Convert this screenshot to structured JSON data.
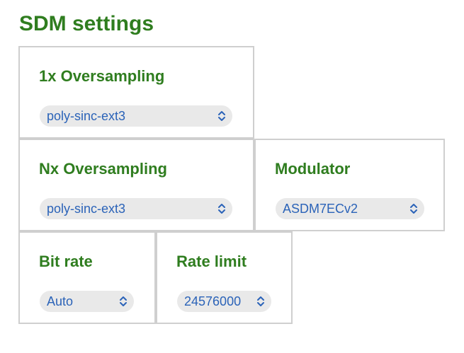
{
  "page": {
    "title": "SDM settings"
  },
  "settings": {
    "oversampling_1x": {
      "label": "1x Oversampling",
      "value": "poly-sinc-ext3"
    },
    "oversampling_nx": {
      "label": "Nx Oversampling",
      "value": "poly-sinc-ext3"
    },
    "modulator": {
      "label": "Modulator",
      "value": "ASDM7ECv2"
    },
    "bit_rate": {
      "label": "Bit rate",
      "value": "Auto"
    },
    "rate_limit": {
      "label": "Rate limit",
      "value": "24576000"
    }
  },
  "icons": {
    "select_chevron": "chevron-up-down-icon"
  },
  "colors": {
    "heading": "#2f7d1f",
    "select_text": "#2b63b8",
    "select_bg": "#e9e9e9",
    "card_border": "#cfcfcf"
  }
}
